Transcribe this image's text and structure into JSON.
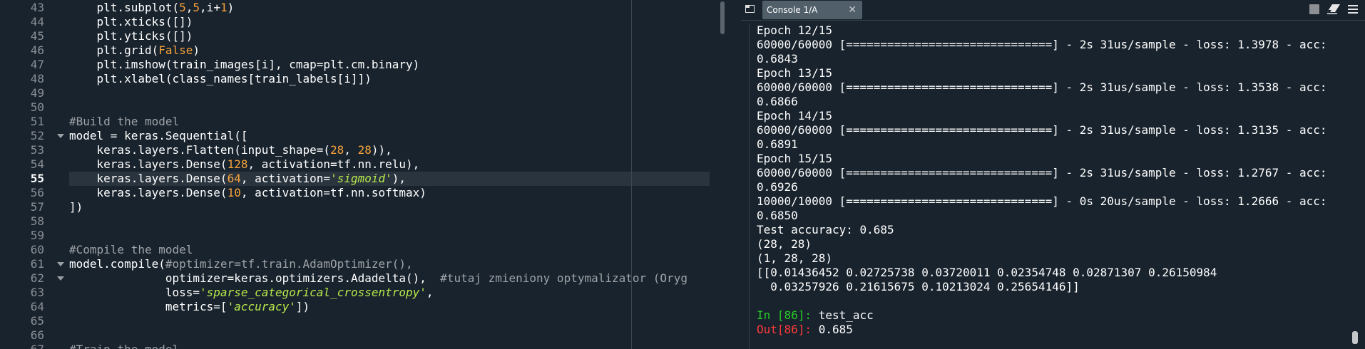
{
  "editor": {
    "lines": [
      {
        "n": "43",
        "code": [
          [
            "    plt.subplot(",
            ""
          ],
          [
            "5",
            "c-num"
          ],
          [
            ",",
            ""
          ],
          [
            "5",
            "c-num"
          ],
          [
            ",i+",
            ""
          ],
          [
            "1",
            "c-num"
          ],
          [
            ")",
            ""
          ]
        ]
      },
      {
        "n": "44",
        "code": [
          [
            "    plt.xticks([])",
            ""
          ]
        ]
      },
      {
        "n": "45",
        "code": [
          [
            "    plt.yticks([])",
            ""
          ]
        ]
      },
      {
        "n": "46",
        "code": [
          [
            "    plt.grid(",
            ""
          ],
          [
            "False",
            "c-kw"
          ],
          [
            ")",
            ""
          ]
        ]
      },
      {
        "n": "47",
        "code": [
          [
            "    plt.imshow(train_images[i], cmap=plt.cm.binary)",
            ""
          ]
        ]
      },
      {
        "n": "48",
        "code": [
          [
            "    plt.xlabel(class_names[train_labels[i]])",
            ""
          ]
        ]
      },
      {
        "n": "49",
        "code": [
          [
            "",
            ""
          ]
        ]
      },
      {
        "n": "50",
        "code": [
          [
            "",
            ""
          ]
        ]
      },
      {
        "n": "51",
        "code": [
          [
            "#Build the model",
            "c-com"
          ]
        ]
      },
      {
        "n": "52",
        "fold": true,
        "code": [
          [
            "model = keras.Sequential([",
            ""
          ]
        ]
      },
      {
        "n": "53",
        "code": [
          [
            "    keras.layers.Flatten(input_shape=(",
            ""
          ],
          [
            "28",
            "c-num"
          ],
          [
            ", ",
            ""
          ],
          [
            "28",
            "c-num"
          ],
          [
            ")),",
            ""
          ]
        ]
      },
      {
        "n": "54",
        "code": [
          [
            "    keras.layers.Dense(",
            ""
          ],
          [
            "128",
            "c-num"
          ],
          [
            ", activation=tf.nn.relu),",
            ""
          ]
        ]
      },
      {
        "n": "55",
        "current": true,
        "code": [
          [
            "    keras.layers.Dense(",
            ""
          ],
          [
            "64",
            "c-num"
          ],
          [
            ", activation=",
            ""
          ],
          [
            "'sigmoid'",
            "c-str"
          ],
          [
            "),",
            ""
          ]
        ]
      },
      {
        "n": "56",
        "code": [
          [
            "    keras.layers.Dense(",
            ""
          ],
          [
            "10",
            "c-num"
          ],
          [
            ", activation=tf.nn.softmax)",
            ""
          ]
        ]
      },
      {
        "n": "57",
        "code": [
          [
            "])",
            ""
          ]
        ]
      },
      {
        "n": "58",
        "code": [
          [
            "",
            ""
          ]
        ]
      },
      {
        "n": "59",
        "code": [
          [
            "",
            ""
          ]
        ]
      },
      {
        "n": "60",
        "code": [
          [
            "#Compile the model",
            "c-com"
          ]
        ]
      },
      {
        "n": "61",
        "fold": true,
        "code": [
          [
            "model.compile(",
            ""
          ],
          [
            "#optimizer=tf.train.AdamOptimizer(),",
            "c-com"
          ]
        ]
      },
      {
        "n": "62",
        "fold": true,
        "code": [
          [
            "              optimizer=keras.optimizers.Adadelta(),  ",
            ""
          ],
          [
            "#tutaj zmieniony optymalizator (Oryg",
            "c-com"
          ]
        ]
      },
      {
        "n": "63",
        "code": [
          [
            "              loss=",
            ""
          ],
          [
            "'sparse_categorical_crossentropy'",
            "c-str"
          ],
          [
            ",",
            ""
          ]
        ]
      },
      {
        "n": "64",
        "code": [
          [
            "              metrics=[",
            ""
          ],
          [
            "'accuracy'",
            "c-str"
          ],
          [
            "])",
            ""
          ]
        ]
      },
      {
        "n": "65",
        "code": [
          [
            "",
            ""
          ]
        ]
      },
      {
        "n": "66",
        "code": [
          [
            "",
            ""
          ]
        ]
      },
      {
        "n": "67",
        "code": [
          [
            "#Train the model",
            "c-com"
          ]
        ]
      }
    ]
  },
  "console": {
    "tab_label": "Console 1/A",
    "tab_close": "✕",
    "lines": [
      [
        [
          "Epoch 12/15",
          ""
        ]
      ],
      [
        [
          "60000/60000 [==============================] - 2s 31us/sample - loss: 1.3978 - acc:",
          ""
        ]
      ],
      [
        [
          "0.6843",
          ""
        ]
      ],
      [
        [
          "Epoch 13/15",
          ""
        ]
      ],
      [
        [
          "60000/60000 [==============================] - 2s 31us/sample - loss: 1.3538 - acc:",
          ""
        ]
      ],
      [
        [
          "0.6866",
          ""
        ]
      ],
      [
        [
          "Epoch 14/15",
          ""
        ]
      ],
      [
        [
          "60000/60000 [==============================] - 2s 31us/sample - loss: 1.3135 - acc:",
          ""
        ]
      ],
      [
        [
          "0.6891",
          ""
        ]
      ],
      [
        [
          "Epoch 15/15",
          ""
        ]
      ],
      [
        [
          "60000/60000 [==============================] - 2s 31us/sample - loss: 1.2767 - acc:",
          ""
        ]
      ],
      [
        [
          "0.6926",
          ""
        ]
      ],
      [
        [
          "10000/10000 [==============================] - 0s 20us/sample - loss: 1.2666 - acc:",
          ""
        ]
      ],
      [
        [
          "0.6850",
          ""
        ]
      ],
      [
        [
          "Test accuracy: 0.685",
          ""
        ]
      ],
      [
        [
          "(28, 28)",
          ""
        ]
      ],
      [
        [
          "(1, 28, 28)",
          ""
        ]
      ],
      [
        [
          "[[0.01436452 0.02725738 0.03720011 0.02354748 0.02871307 0.26150984",
          ""
        ]
      ],
      [
        [
          "  0.03257926 0.21615675 0.10213024 0.25654146]]",
          ""
        ]
      ],
      [
        [
          "",
          ""
        ]
      ],
      [
        [
          "In [",
          "c-in"
        ],
        [
          "86",
          "c-in"
        ],
        [
          "]: ",
          "c-in"
        ],
        [
          "test_acc",
          ""
        ]
      ],
      [
        [
          "Out[",
          "c-out"
        ],
        [
          "86",
          "c-out"
        ],
        [
          "]: ",
          "c-out"
        ],
        [
          "0.685",
          ""
        ]
      ]
    ]
  },
  "colors": {
    "background": "#19232d",
    "number": "#f6a23b",
    "string": "#b6e84a",
    "comment": "#9ea3a8",
    "prompt_in": "#26cc26",
    "prompt_out": "#ff3a3a"
  }
}
